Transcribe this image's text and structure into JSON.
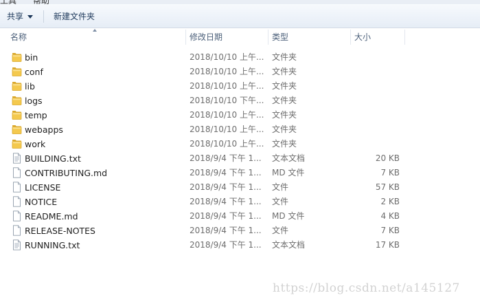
{
  "top_strip": {
    "left_text": "工具",
    "right_text": "帮助"
  },
  "toolbar": {
    "share_label": "共享",
    "new_folder_label": "新建文件夹"
  },
  "columns": {
    "name": "名称",
    "date": "修改日期",
    "type": "类型",
    "size": "大小"
  },
  "files": [
    {
      "name": "bin",
      "date": "2018/10/10 上午...",
      "type": "文件夹",
      "size": "",
      "icon": "folder-icon"
    },
    {
      "name": "conf",
      "date": "2018/10/10 上午...",
      "type": "文件夹",
      "size": "",
      "icon": "folder-icon"
    },
    {
      "name": "lib",
      "date": "2018/10/10 上午...",
      "type": "文件夹",
      "size": "",
      "icon": "folder-icon"
    },
    {
      "name": "logs",
      "date": "2018/10/10 下午...",
      "type": "文件夹",
      "size": "",
      "icon": "folder-icon"
    },
    {
      "name": "temp",
      "date": "2018/10/10 上午...",
      "type": "文件夹",
      "size": "",
      "icon": "folder-icon"
    },
    {
      "name": "webapps",
      "date": "2018/10/10 上午...",
      "type": "文件夹",
      "size": "",
      "icon": "folder-icon"
    },
    {
      "name": "work",
      "date": "2018/10/10 上午...",
      "type": "文件夹",
      "size": "",
      "icon": "folder-icon"
    },
    {
      "name": "BUILDING.txt",
      "date": "2018/9/4 下午 1...",
      "type": "文本文档",
      "size": "20 KB",
      "icon": "text-document-icon"
    },
    {
      "name": "CONTRIBUTING.md",
      "date": "2018/9/4 下午 1...",
      "type": "MD 文件",
      "size": "7 KB",
      "icon": "file-icon"
    },
    {
      "name": "LICENSE",
      "date": "2018/9/4 下午 1...",
      "type": "文件",
      "size": "57 KB",
      "icon": "file-icon"
    },
    {
      "name": "NOTICE",
      "date": "2018/9/4 下午 1...",
      "type": "文件",
      "size": "2 KB",
      "icon": "file-icon"
    },
    {
      "name": "README.md",
      "date": "2018/9/4 下午 1...",
      "type": "MD 文件",
      "size": "4 KB",
      "icon": "file-icon"
    },
    {
      "name": "RELEASE-NOTES",
      "date": "2018/9/4 下午 1...",
      "type": "文件",
      "size": "7 KB",
      "icon": "file-icon"
    },
    {
      "name": "RUNNING.txt",
      "date": "2018/9/4 下午 1...",
      "type": "文本文档",
      "size": "17 KB",
      "icon": "text-document-icon"
    }
  ],
  "watermark": "https://blog.csdn.net/a145127"
}
